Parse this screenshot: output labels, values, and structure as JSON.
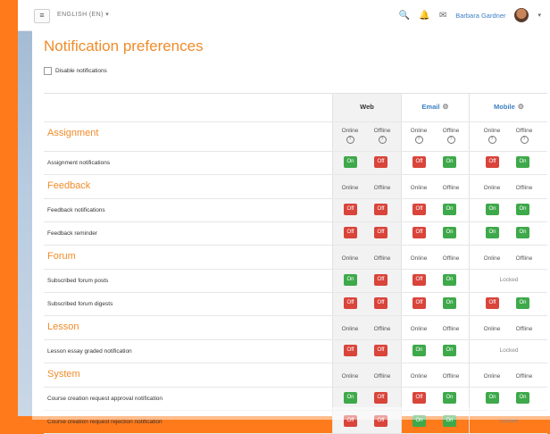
{
  "nav": {
    "language": "ENGLISH (EN) ▾",
    "user_name": "Barbara Gardner"
  },
  "page": {
    "title": "Notification preferences",
    "disable_label": "Disable notifications"
  },
  "columns": {
    "web": "Web",
    "email": "Email",
    "mobile": "Mobile",
    "online": "Online",
    "offline": "Offline",
    "locked": "Locked"
  },
  "sections": [
    {
      "title": "Assignment"
    },
    {
      "title": "Feedback"
    },
    {
      "title": "Forum"
    },
    {
      "title": "Lesson"
    },
    {
      "title": "System"
    }
  ],
  "items": [
    {
      "label": "Assignment notifications",
      "web": [
        "On",
        "Off"
      ],
      "email": [
        "Off",
        "On"
      ],
      "mobile": [
        "Off",
        "On"
      ]
    },
    {
      "label": "Feedback notifications",
      "web": [
        "Off",
        "Off"
      ],
      "email": [
        "Off",
        "On"
      ],
      "mobile": [
        "On",
        "On"
      ]
    },
    {
      "label": "Feedback reminder",
      "web": [
        "Off",
        "Off"
      ],
      "email": [
        "Off",
        "On"
      ],
      "mobile": [
        "On",
        "On"
      ]
    },
    {
      "label": "Subscribed forum posts",
      "web": [
        "On",
        "Off"
      ],
      "email": [
        "Off",
        "On"
      ],
      "mobile": "Locked"
    },
    {
      "label": "Subscribed forum digests",
      "web": [
        "Off",
        "Off"
      ],
      "email": [
        "Off",
        "On"
      ],
      "mobile": [
        "Off",
        "On"
      ]
    },
    {
      "label": "Lesson essay graded notification",
      "web": [
        "Off",
        "Off"
      ],
      "email": [
        "On",
        "On"
      ],
      "mobile": "Locked"
    },
    {
      "label": "Course creation request approval notification",
      "web": [
        "On",
        "Off"
      ],
      "email": [
        "Off",
        "On"
      ],
      "mobile": [
        "On",
        "On"
      ]
    },
    {
      "label": "Course creation request rejection notification",
      "web": [
        "Off",
        "Off"
      ],
      "email": [
        "On",
        "On"
      ],
      "mobile": "Locked"
    }
  ],
  "colors": {
    "accent": "#f08c2a",
    "on": "#3ea94a",
    "off": "#d9443b",
    "link": "#3b7fc4"
  }
}
